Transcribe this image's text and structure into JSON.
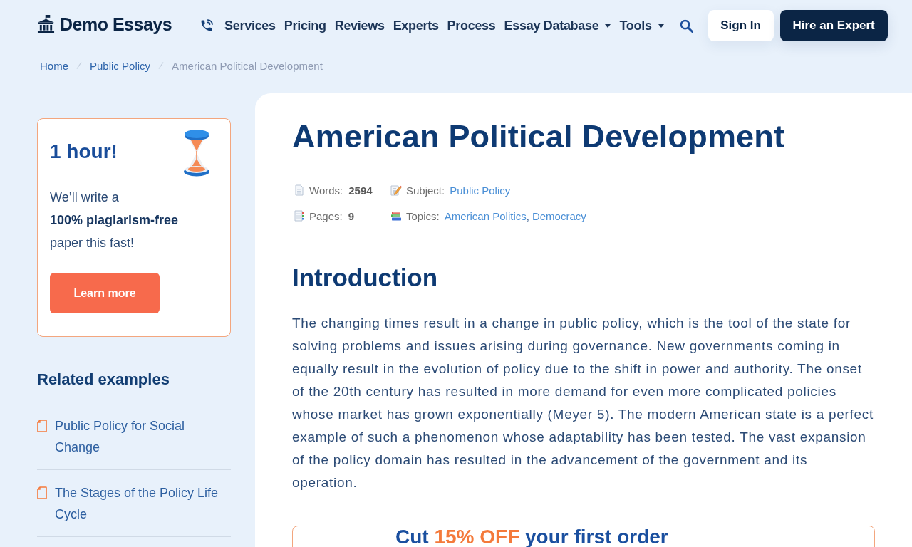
{
  "header": {
    "logo": "Demo Essays",
    "nav": [
      {
        "label": "Services",
        "dropdown": false
      },
      {
        "label": "Pricing",
        "dropdown": false
      },
      {
        "label": "Reviews",
        "dropdown": false
      },
      {
        "label": "Experts",
        "dropdown": false
      },
      {
        "label": "Process",
        "dropdown": false
      },
      {
        "label": "Essay Database",
        "dropdown": true
      },
      {
        "label": "Tools",
        "dropdown": true
      }
    ],
    "sign_in": "Sign In",
    "cta": "Hire an Expert"
  },
  "breadcrumb": {
    "links": [
      "Home",
      "Public Policy"
    ],
    "current": "American Political Development"
  },
  "sidebar": {
    "promo": {
      "title": "1 hour!",
      "text": "We’ll write a **100% plagiarism-free** paper this fast!",
      "button": "Learn more"
    },
    "related": {
      "title": "Related examples",
      "items": [
        "Public Policy for Social Change",
        "The Stages of the Policy Life Cycle"
      ]
    }
  },
  "article": {
    "title": "American Political Development",
    "meta": [
      {
        "kind": "words",
        "label": "Words:",
        "value": "2594"
      },
      {
        "kind": "subject",
        "label": "Subject:",
        "links": [
          "Public Policy"
        ]
      },
      {
        "kind": "pages",
        "label": "Pages:",
        "value": "9"
      },
      {
        "kind": "topics",
        "label": "Topics:",
        "links": [
          "American Politics",
          "Democracy"
        ],
        "separator": ","
      }
    ],
    "heading": "Introduction",
    "paragraph": "The changing times result in a change in public policy, which is the tool of the state for solving problems and issues arising during governance. New governments coming in equally result in the evolution of policy due to the shift in power and authority. The onset of the 20th century has resulted in more demand for even more complicated policies whose market has grown exponentially (Meyer 5). The modern American state is a perfect example of such a phenomenon whose adaptability has been tested. The vast expansion of the policy domain has resulted in the advancement of the government and its operation.",
    "offer": {
      "before": "Cut",
      "highlight": "15% OFF",
      "after": "your first order"
    }
  }
}
